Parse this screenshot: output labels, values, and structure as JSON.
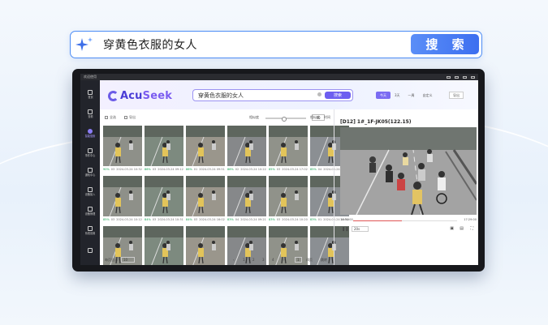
{
  "hero": {
    "query": "穿黄色衣服的女人",
    "search_label": "搜 索"
  },
  "app": {
    "status_left": "欢迎使用",
    "logo_main": "Acu",
    "logo_accent": "Seek",
    "search_value": "穿黄色衣服的女人",
    "search_button": "搜索",
    "time_ranges": [
      "今天",
      "3天",
      "一周",
      "自定义"
    ],
    "export_label": "导出",
    "sidebar": [
      {
        "label": "首页",
        "icon": "home-icon"
      },
      {
        "label": "查看",
        "icon": "view-icon"
      },
      {
        "label": "智能搜索",
        "icon": "ai-search-icon",
        "active": true
      },
      {
        "label": "事件中心",
        "icon": "event-icon"
      },
      {
        "label": "通知中心",
        "icon": "notify-icon"
      },
      {
        "label": "设备接入",
        "icon": "device-icon"
      },
      {
        "label": "设备管理",
        "icon": "device-manage-icon"
      },
      {
        "label": "系统设置",
        "icon": "settings-icon"
      },
      {
        "label": "",
        "icon": "user-icon"
      }
    ],
    "toolbar": {
      "select_all": "全选",
      "deselect": "导出",
      "similarity_label": "相似度",
      "similarity_value": "40",
      "sort_label": "相似度",
      "time_label": "时间"
    },
    "results": [
      {
        "score": "90%",
        "cam": "03",
        "date": "2024-03-24 10:32"
      },
      {
        "score": "86%",
        "cam": "03",
        "date": "2024-03-24 09:12"
      },
      {
        "score": "86%",
        "cam": "01",
        "date": "2024-03-24 09:51"
      },
      {
        "score": "86%",
        "cam": "02",
        "date": "2024-03-24 10:22"
      },
      {
        "score": "85%",
        "cam": "03",
        "date": "2024-03-24 17:02"
      },
      {
        "score": "85%",
        "cam": "04",
        "date": "2024-03-24 09:32"
      },
      {
        "score": "85%",
        "cam": "03",
        "date": "2024-03-24 10:12"
      },
      {
        "score": "84%",
        "cam": "03",
        "date": "2024-03-24 10:31"
      },
      {
        "score": "84%",
        "cam": "03",
        "date": "2024-03-24 16:02"
      },
      {
        "score": "83%",
        "cam": "04",
        "date": "2024-03-24 09:21"
      },
      {
        "score": "83%",
        "cam": "03",
        "date": "2024-03-24 10:20"
      },
      {
        "score": "83%",
        "cam": "01",
        "date": "2024-03-24 10:52"
      },
      {
        "score": "",
        "cam": "",
        "date": ""
      },
      {
        "score": "",
        "cam": "",
        "date": ""
      },
      {
        "score": "",
        "cam": "",
        "date": ""
      },
      {
        "score": "",
        "cam": "",
        "date": ""
      },
      {
        "score": "",
        "cam": "",
        "date": ""
      },
      {
        "score": "",
        "cam": "",
        "date": ""
      }
    ],
    "pager": {
      "per_page_label": "每页显示",
      "per_page": "10",
      "pages": [
        "1",
        "2",
        "3",
        "4"
      ],
      "current": "1",
      "total": "/4页",
      "jump": "跳转"
    },
    "viewer": {
      "title": "[D12] 1#_1F-JK05(122.15)",
      "time_start": "14:54:00",
      "time_end": "17:29:00",
      "speed": "20s"
    }
  }
}
